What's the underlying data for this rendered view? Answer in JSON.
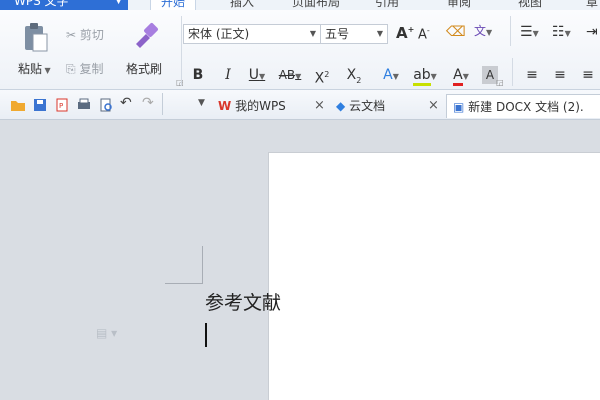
{
  "app": {
    "menu_label": "WPS 文字",
    "tabs": [
      "开始",
      "插入",
      "页面布局",
      "引用",
      "审阅",
      "视图",
      "章"
    ]
  },
  "ribbon": {
    "clipboard": {
      "paste": "粘贴",
      "cut": "剪切",
      "copy": "复制",
      "format_painter": "格式刷"
    },
    "font": {
      "name": "宋体 (正文)",
      "size": "五号"
    }
  },
  "doc_tabs": [
    {
      "label": "我的WPS"
    },
    {
      "label": "云文档"
    },
    {
      "label": "新建 DOCX 文档 (2)."
    }
  ],
  "document": {
    "text": "参考文献"
  },
  "colors": {
    "accent": "#2e6fd6",
    "wps_red": "#d9362b",
    "cloud_blue": "#2f7fe0",
    "font_color_red": "#e02020"
  }
}
